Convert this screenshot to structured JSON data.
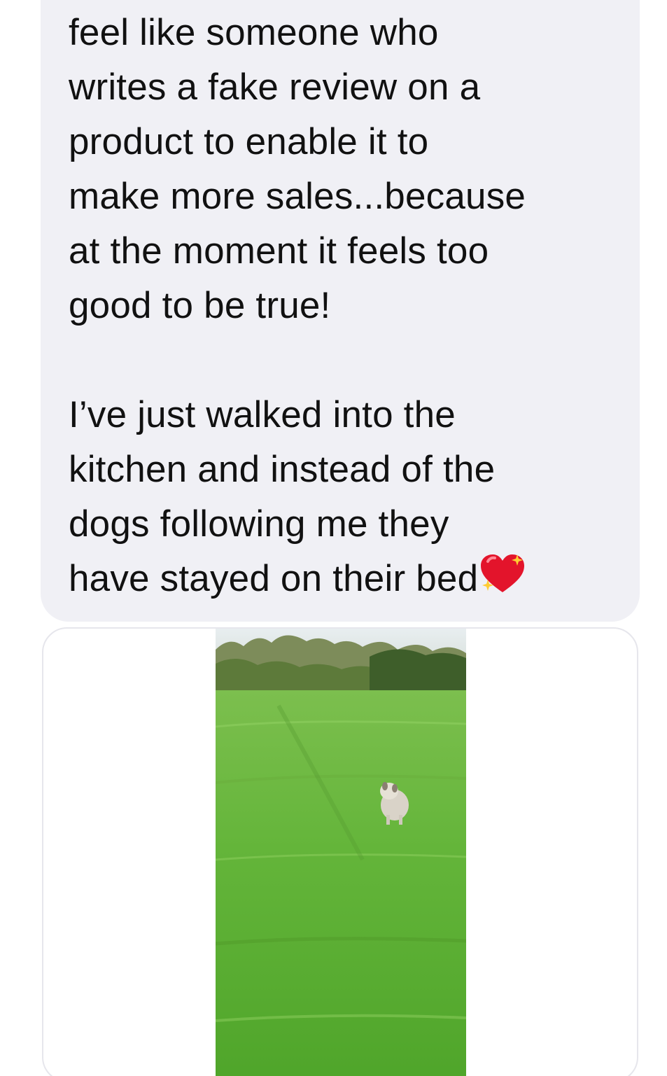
{
  "message": {
    "paragraph_1": "feel like someone who\nwrites a fake review on a\nproduct to enable it to\nmake more sales...because\nat the moment it feels too\ngood to be true!",
    "paragraph_2": "I’ve just walked into the\nkitchen and instead of the\ndogs following me they\nhave stayed on their bed",
    "emoji": "sparkling-heart-icon"
  },
  "attachment": {
    "type": "photo",
    "scene": "dog-in-grass-field"
  },
  "colors": {
    "bubble_bg": "#f0f0f5",
    "text": "#111111",
    "grass": "#5fb33a",
    "heart": "#e3142b"
  }
}
